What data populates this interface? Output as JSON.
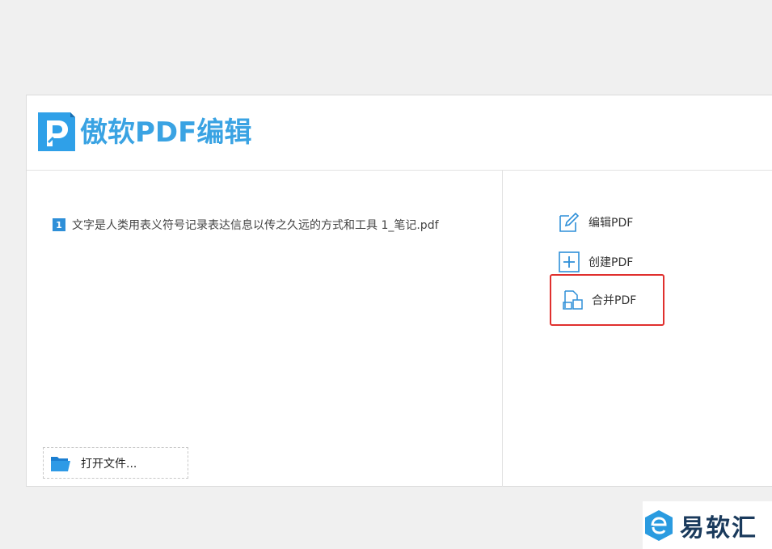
{
  "app": {
    "title": "傲软PDF编辑"
  },
  "recent_files": [
    {
      "index": "1",
      "name": "文字是人类用表义符号记录表达信息以传之久远的方式和工具 1_笔记.pdf"
    }
  ],
  "open_file": {
    "label": "打开文件..."
  },
  "actions": [
    {
      "label": "编辑PDF",
      "icon": "edit-icon"
    },
    {
      "label": "创建PDF",
      "icon": "add-icon"
    },
    {
      "label": "合并PDF",
      "icon": "merge-icon"
    }
  ],
  "watermark": {
    "text": "易软汇"
  },
  "colors": {
    "brand": "#3aa3e3",
    "highlight": "#e0302e",
    "accent": "#2e8fd8"
  }
}
